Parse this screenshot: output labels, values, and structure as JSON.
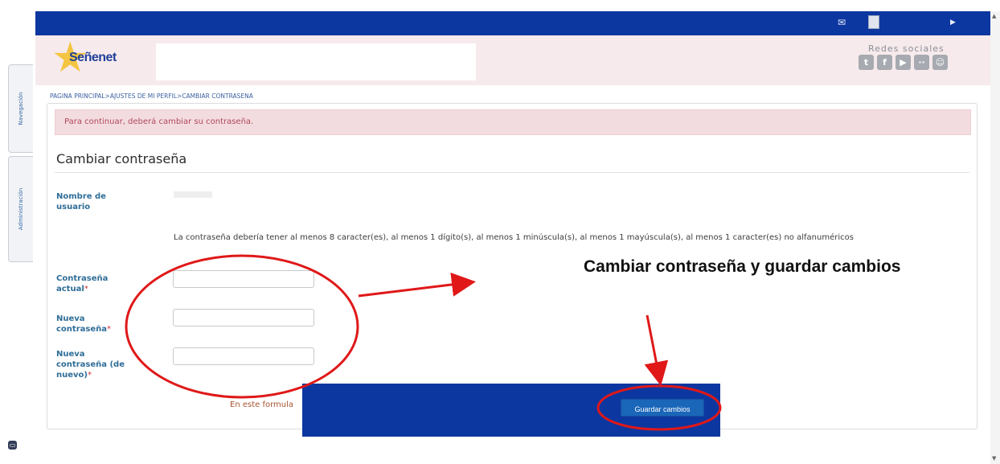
{
  "header": {
    "brand_name": "Señenet",
    "social_title": "Redes sociales",
    "social_icons": [
      "twitter-icon",
      "facebook-icon",
      "youtube-icon",
      "flickr-icon",
      "chat-icon"
    ]
  },
  "sidebar": {
    "tabs": [
      {
        "label": "Navegación"
      },
      {
        "label": "Administración"
      }
    ]
  },
  "breadcrumb": "PAGINA PRINCIPAL>AJUSTES DE MI PERFIL>CAMBIAR CONTRASENA",
  "alert": {
    "text": "Para continuar, deberá cambiar su contraseña."
  },
  "form": {
    "title": "Cambiar contraseña",
    "username_label": "Nombre de usuario",
    "password_rules": "La contraseña debería tener al menos 8 caracter(es), al menos 1 dígito(s), al menos 1 minúscula(s), al menos 1 mayúscula(s), al menos 1 caracter(es) no alfanuméricos",
    "current_password_label": "Contraseña actual",
    "new_password_label": "Nueva contraseña",
    "new_password_again_label": "Nueva contraseña (de nuevo)",
    "required_mark": "*",
    "form_note": "En este formula",
    "save_button": "Guardar cambios"
  },
  "annotation": {
    "text": "Cambiar contraseña y guardar cambios",
    "color": "#e01818"
  },
  "colors": {
    "topbar": "#0d37a0",
    "alert_bg": "#f3dcdf",
    "label_blue": "#2f6d97",
    "button_blue": "#1a66b9"
  }
}
